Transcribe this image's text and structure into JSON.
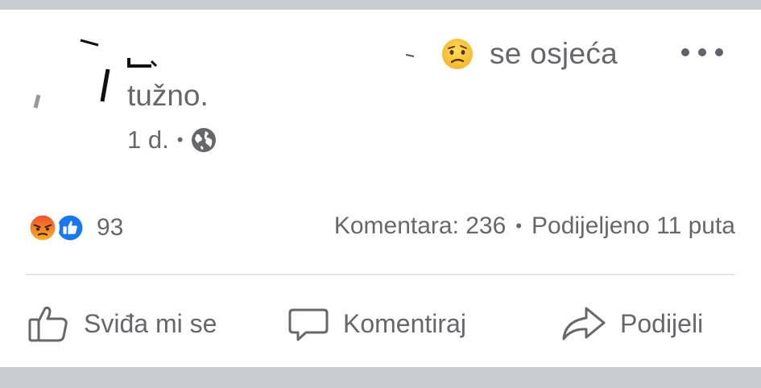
{
  "post": {
    "feeling_text": "se osjeća",
    "feeling_line2": "tužno.",
    "feeling_icon": "sad-face-emoji",
    "time": "1 d.",
    "time_separator": "•",
    "privacy_icon": "globe-icon"
  },
  "reactions": {
    "types": [
      "angry-reaction-icon",
      "like-reaction-icon"
    ],
    "count": "93"
  },
  "stats": {
    "comments": "Komentara: 236",
    "separator": "•",
    "shares": "Podijeljeno 11 puta"
  },
  "actions": {
    "like": "Sviđa mi se",
    "comment": "Komentiraj",
    "share": "Podijeli"
  },
  "colors": {
    "secondary_text": "#65676b",
    "divider": "#e4e6eb",
    "background_strip": "#c9ccd1",
    "like_blue": "#1877f2",
    "angry_orange": "#f0522a"
  }
}
